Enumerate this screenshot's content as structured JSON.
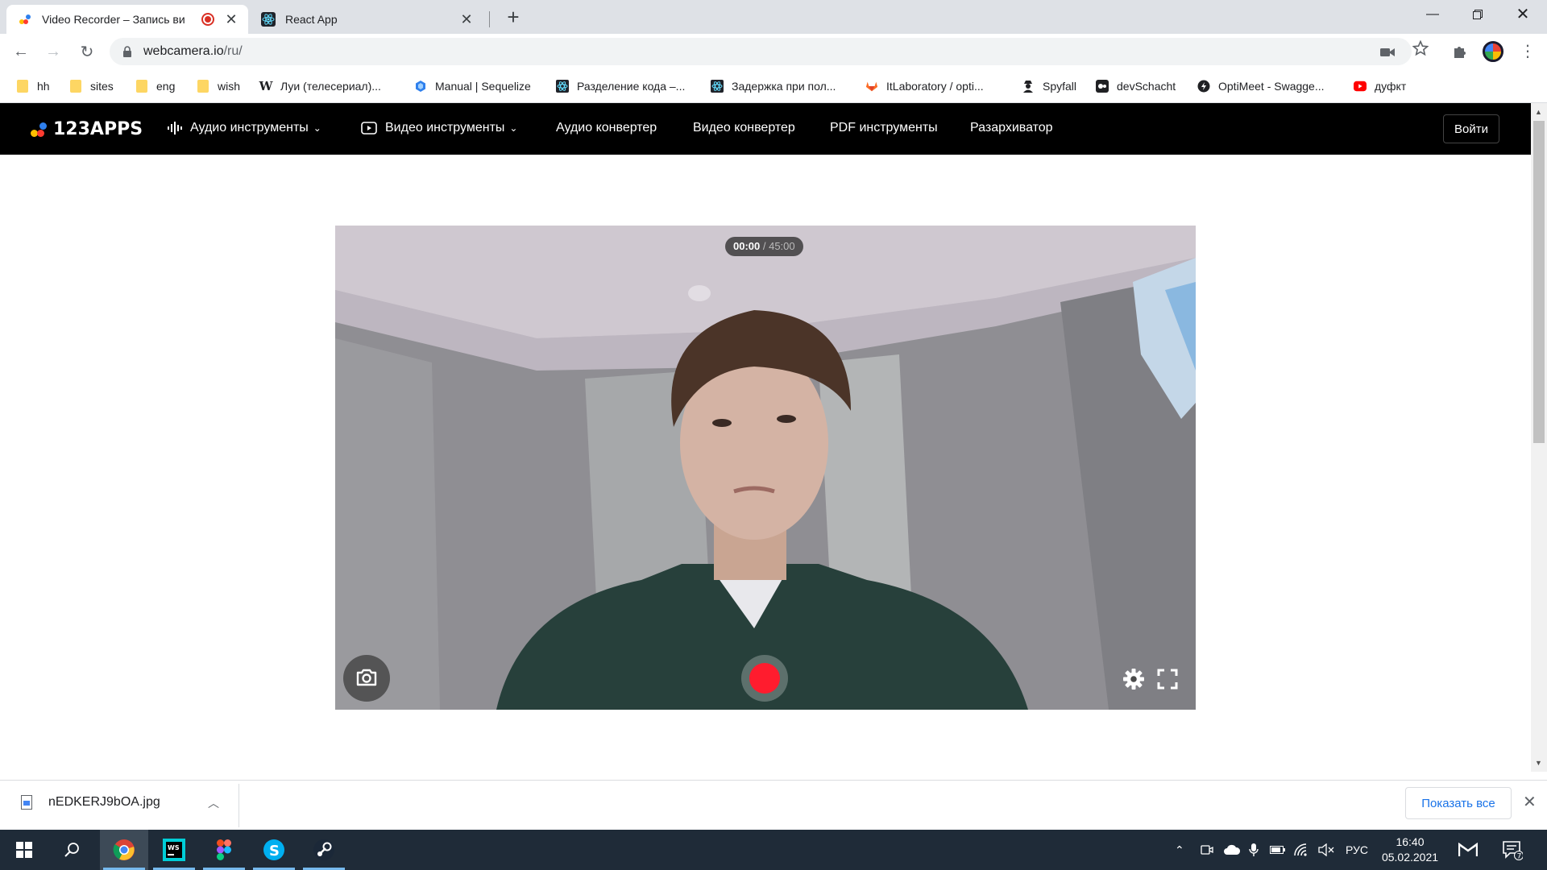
{
  "browser": {
    "tabs": [
      {
        "title": "Video Recorder – Запись ви",
        "active": true,
        "recording": true
      },
      {
        "title": "React App",
        "active": false
      }
    ],
    "url_host": "webcamera.io",
    "url_path": "/ru/",
    "bookmarks": [
      {
        "label": "hh",
        "icon": "folder-icon"
      },
      {
        "label": "sites",
        "icon": "folder-icon"
      },
      {
        "label": "eng",
        "icon": "folder-icon"
      },
      {
        "label": "wish",
        "icon": "folder-icon"
      },
      {
        "label": "Луи (телесериал)...",
        "icon": "wikipedia-icon"
      },
      {
        "label": "Manual | Sequelize",
        "icon": "sequelize-icon"
      },
      {
        "label": "Разделение кода –...",
        "icon": "react-icon"
      },
      {
        "label": "Задержка при пол...",
        "icon": "react-icon"
      },
      {
        "label": "ItLaboratory / opti...",
        "icon": "gitlab-icon"
      },
      {
        "label": "Spyfall",
        "icon": "spy-icon"
      },
      {
        "label": "devSchacht",
        "icon": "devschacht-icon"
      },
      {
        "label": "OptiMeet - Swagge...",
        "icon": "swagger-icon"
      },
      {
        "label": "дуфкт",
        "icon": "youtube-icon"
      }
    ]
  },
  "site": {
    "logo": "123APPS",
    "nav": [
      {
        "label": "Аудио инструменты",
        "icon": "audio-wave-icon",
        "dropdown": true
      },
      {
        "label": "Видео инструменты",
        "icon": "video-play-icon",
        "dropdown": true
      },
      {
        "label": "Аудио конвертер"
      },
      {
        "label": "Видео конвертер"
      },
      {
        "label": "PDF инструменты"
      },
      {
        "label": "Разархиватор"
      }
    ],
    "login": "Войти",
    "logo_colors": [
      "#ffbf00",
      "#ff3b30",
      "#2f80ed"
    ]
  },
  "recorder": {
    "elapsed": "00:00",
    "total": " / 45:00",
    "record_color": "#ff1c2e"
  },
  "downloads": {
    "file": "nEDKERJ9bOA.jpg",
    "show_all": "Показать все"
  },
  "taskbar": {
    "apps": [
      "windows-start-icon",
      "search-icon",
      "chrome-icon",
      "webstorm-icon",
      "figma-icon",
      "skype-icon",
      "steam-icon"
    ],
    "language": "РУС",
    "time": "16:40",
    "date": "05.02.2021",
    "notification_count": "7"
  }
}
